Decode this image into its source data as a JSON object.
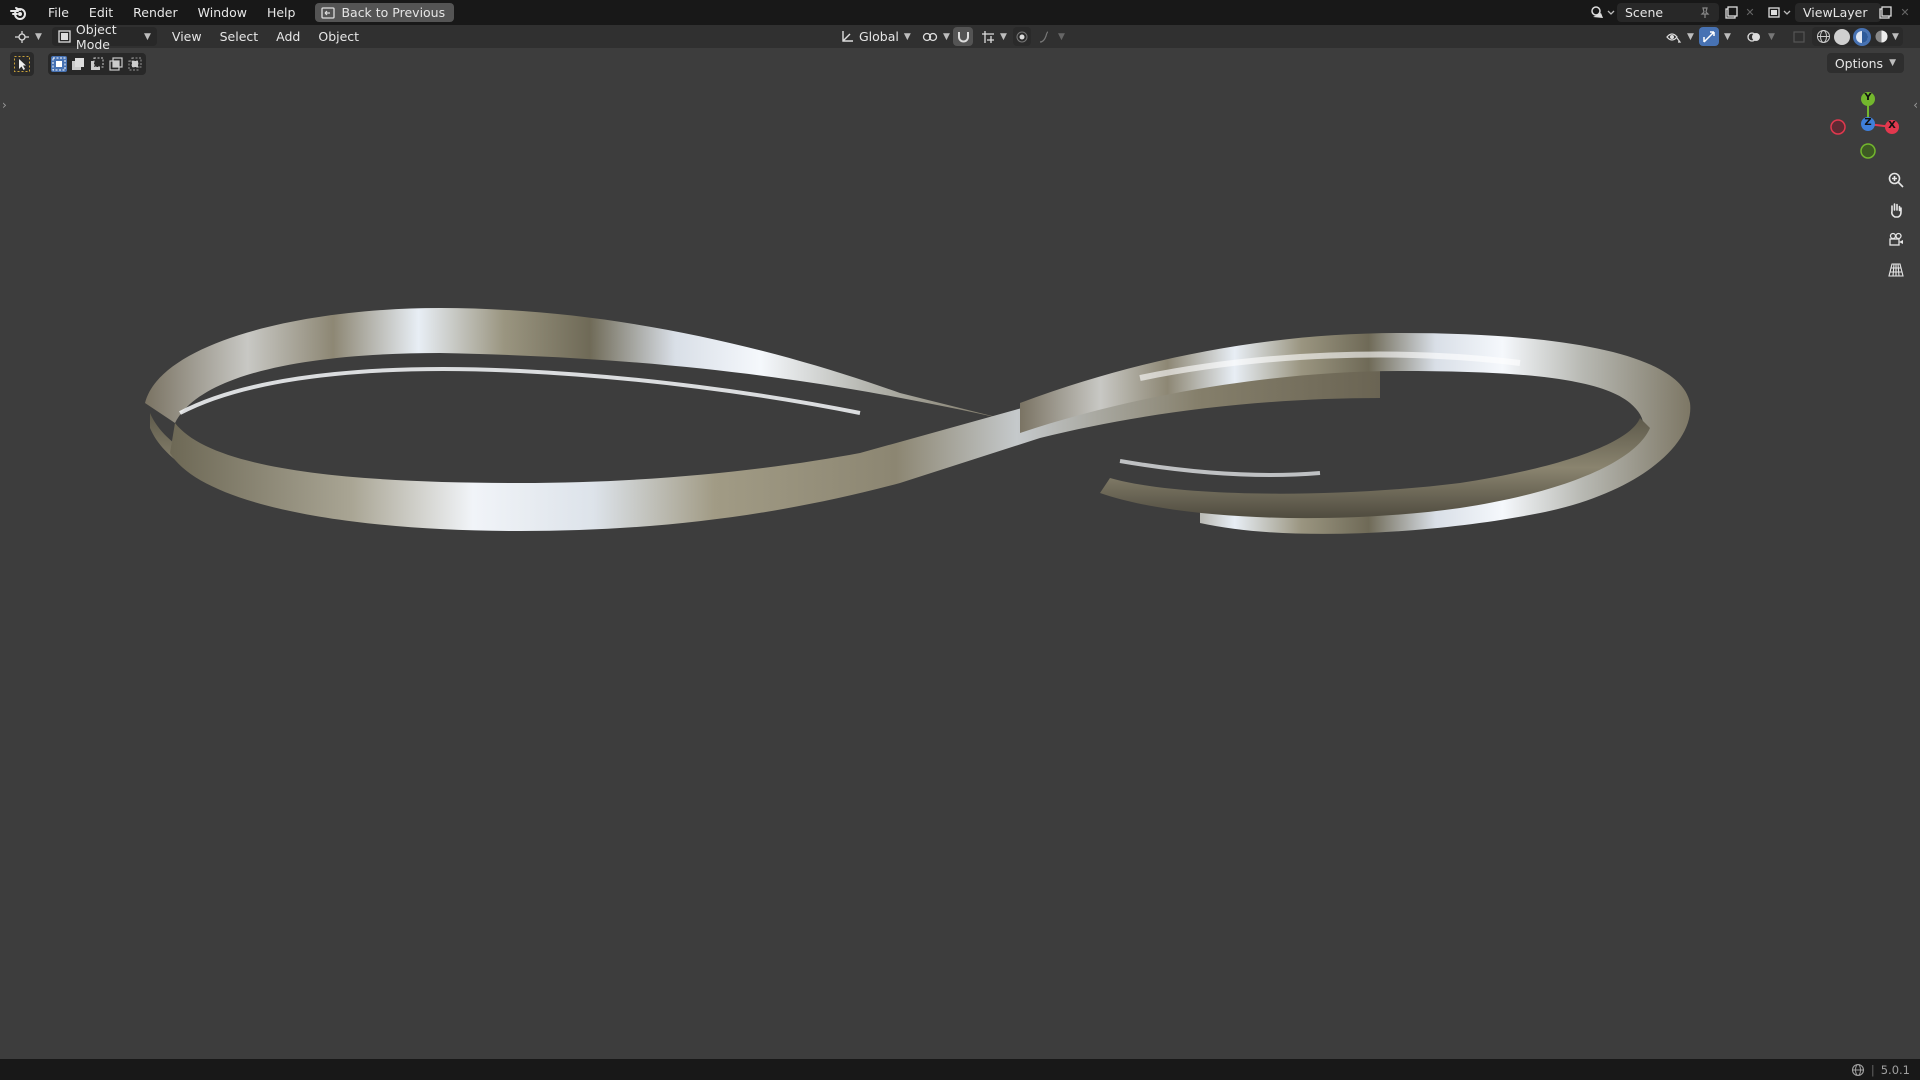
{
  "topbar": {
    "menus": [
      "File",
      "Edit",
      "Render",
      "Window",
      "Help"
    ],
    "back_button": "Back to Previous",
    "scene": "Scene",
    "view_layer": "ViewLayer"
  },
  "header": {
    "mode": "Object Mode",
    "menus": [
      "View",
      "Select",
      "Add",
      "Object"
    ],
    "transform_orientation": "Global"
  },
  "viewport": {
    "options_label": "Options",
    "gizmo": {
      "y": "Y",
      "z": "Z",
      "x": "X"
    },
    "background_color": "#3d3d3d",
    "object": "twisted metallic ring (figure-eight band)"
  },
  "statusbar": {
    "version": "5.0.1"
  },
  "colors": {
    "accent": "#4772b3",
    "axis_x": "#e2384e",
    "axis_y": "#73b72d",
    "axis_z": "#3f7fd9"
  }
}
